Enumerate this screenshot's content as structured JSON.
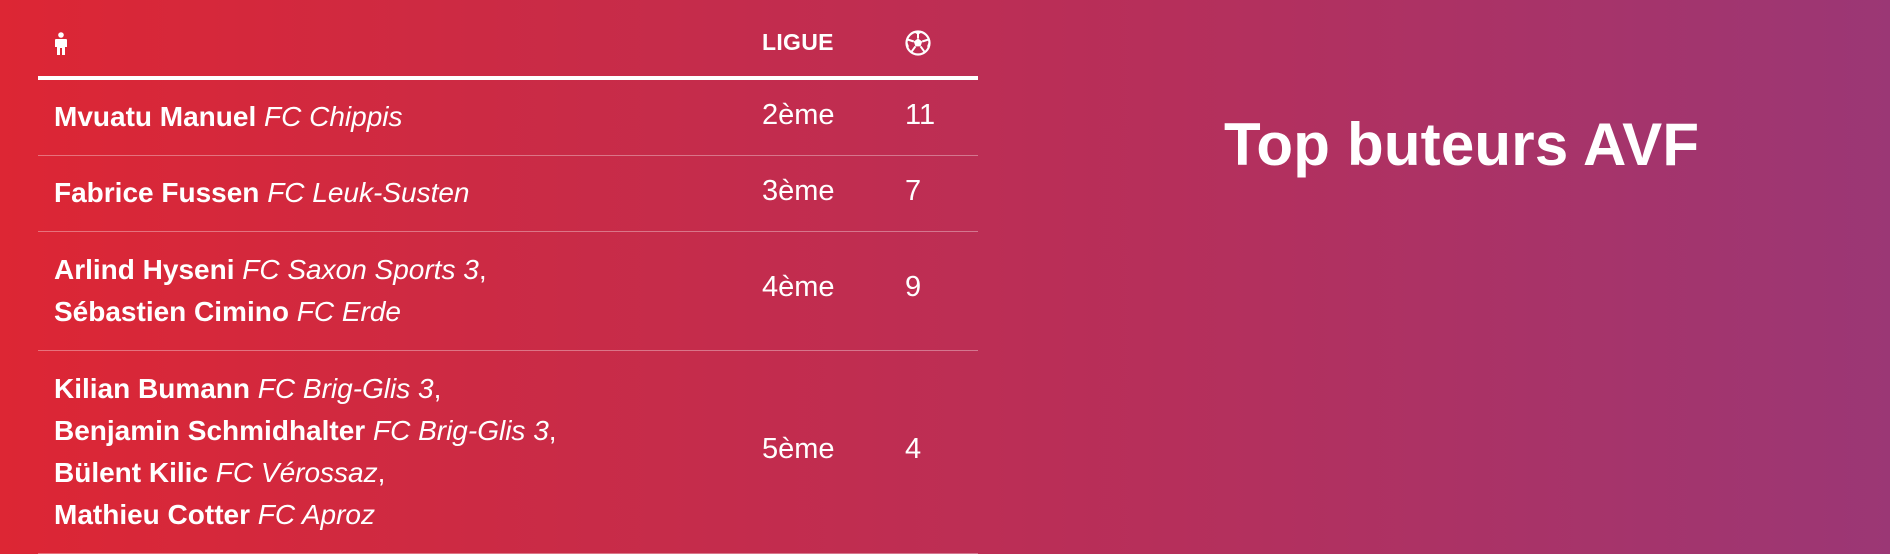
{
  "title": "Top buteurs AVF",
  "table": {
    "header": {
      "player_icon": "person-icon",
      "ligue": "LIGUE",
      "goals_icon": "soccer-ball-icon"
    },
    "rows": [
      {
        "players": [
          {
            "name": "Mvuatu Manuel",
            "club": "FC Chippis",
            "sep": ""
          }
        ],
        "ligue": "2ème",
        "goals": "11"
      },
      {
        "players": [
          {
            "name": "Fabrice Fussen",
            "club": "FC Leuk-Susten",
            "sep": ""
          }
        ],
        "ligue": "3ème",
        "goals": "7"
      },
      {
        "players": [
          {
            "name": "Arlind Hyseni",
            "club": "FC Saxon Sports 3",
            "sep": ","
          },
          {
            "name": "Sébastien Cimino",
            "club": "FC Erde",
            "sep": ""
          }
        ],
        "ligue": "4ème",
        "goals": "9"
      },
      {
        "players": [
          {
            "name": "Kilian Bumann",
            "club": "FC Brig-Glis 3",
            "sep": ","
          },
          {
            "name": "Benjamin Schmidhalter",
            "club": "FC Brig-Glis 3",
            "sep": ","
          },
          {
            "name": "Bülent Kilic",
            "club": "FC Vérossaz",
            "sep": ","
          },
          {
            "name": "Mathieu Cotter",
            "club": "FC Aproz",
            "sep": ""
          }
        ],
        "ligue": "5ème",
        "goals": "4"
      }
    ]
  },
  "colors": {
    "gradient_start": "#dd2634",
    "gradient_end": "#9b3775",
    "text": "#ffffff"
  }
}
